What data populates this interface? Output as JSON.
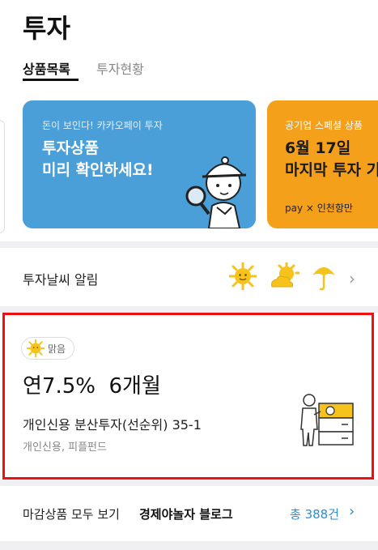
{
  "header": {
    "title": "투자"
  },
  "tabs": [
    {
      "label": "상품목록",
      "active": true
    },
    {
      "label": "투자현황",
      "active": false
    }
  ],
  "banners": [
    {
      "subtitle": "돈이 보인다! 카카오페이 투자",
      "line1": "투자상품",
      "line2": "미리 확인하세요!",
      "color": "#4a9fd9"
    },
    {
      "subtitle": "공기업 스페셜 상품",
      "line1": "6월 17일",
      "line2": "마지막 투자 기",
      "footer": "pay × 인천항만",
      "color": "#f5a01b"
    }
  ],
  "weather": {
    "label": "투자날씨 알림",
    "icons": [
      "sun-icon",
      "partly-cloudy-icon",
      "umbrella-icon"
    ]
  },
  "product": {
    "badge": "맑음",
    "rate": "연7.5%",
    "term": "6개월",
    "name": "개인신용 분산투자(선순위) 35-1",
    "category": "개인신용, 피플펀드"
  },
  "footer": {
    "label": "마감상품 모두 보기",
    "blog": "경제야놀자 블로그",
    "count": "총 388건"
  },
  "colors": {
    "accent_blue": "#2a8fd4",
    "banner_blue": "#4a9fd9",
    "banner_orange": "#f5a01b",
    "highlight": "#ee1111",
    "sun": "#f6c21c"
  }
}
